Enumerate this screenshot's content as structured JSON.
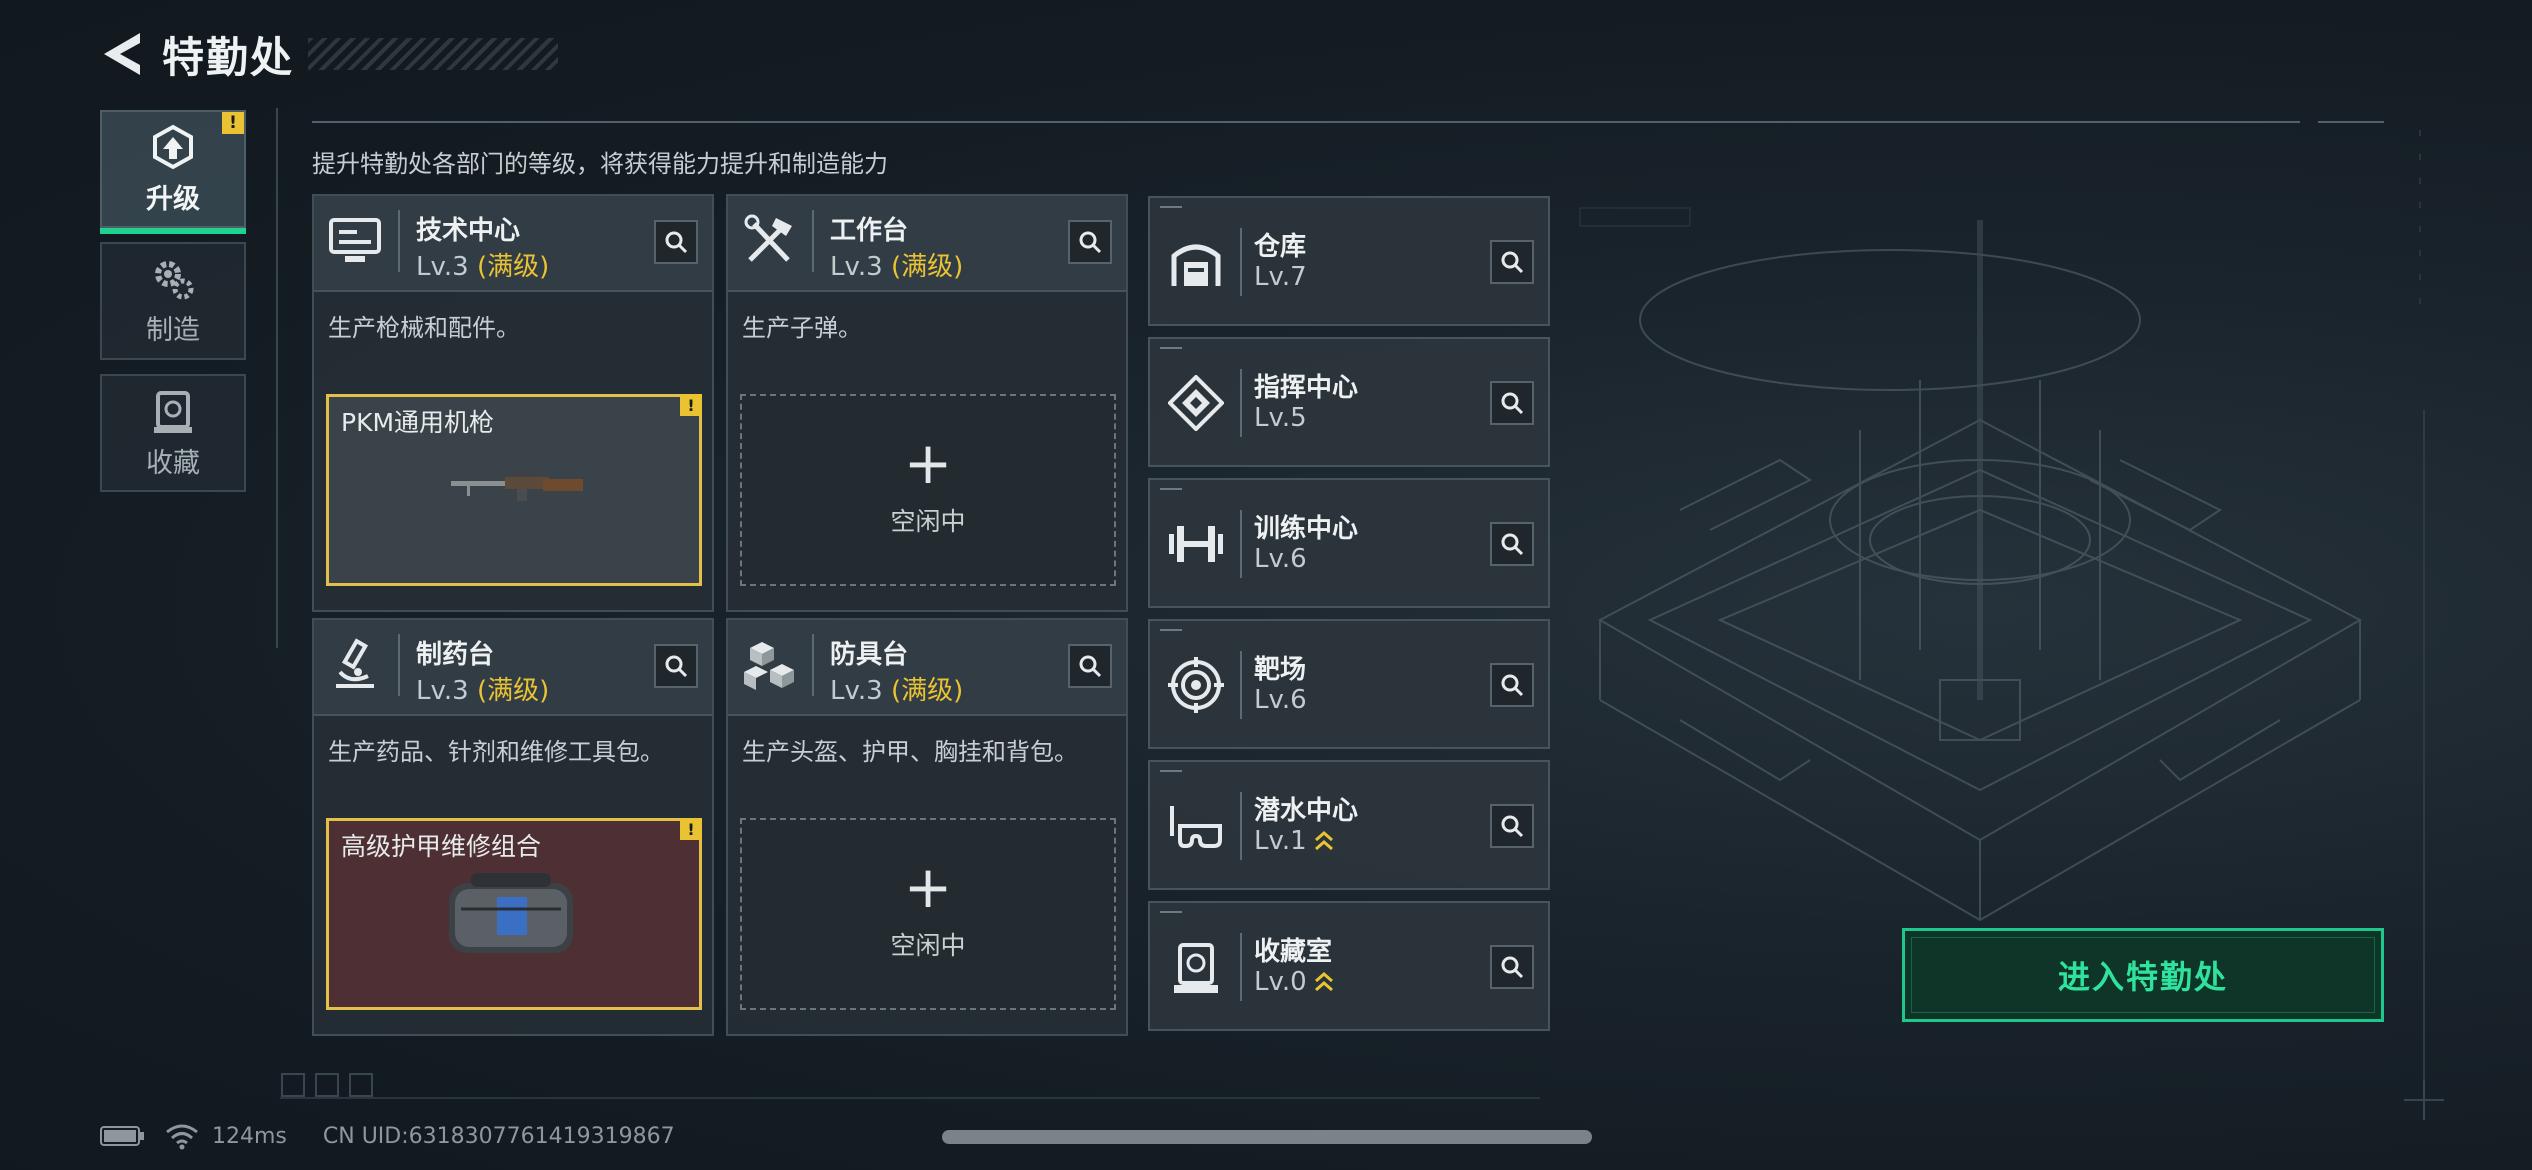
{
  "header": {
    "title": "特勤处"
  },
  "tabs": [
    {
      "id": "upgrade",
      "label": "升级",
      "active": true,
      "badge": "!"
    },
    {
      "id": "craft",
      "label": "制造",
      "active": false
    },
    {
      "id": "collection",
      "label": "收藏",
      "active": false
    }
  ],
  "description": "提升特勤处各部门的等级，将获得能力提升和制造能力",
  "departments": [
    {
      "name": "技术中心",
      "level": "Lv.3",
      "max_label": "(满级)",
      "desc": "生产枪械和配件。",
      "slot": {
        "type": "item",
        "name": "PKM通用机枪",
        "badge": "!",
        "color": "grey"
      }
    },
    {
      "name": "工作台",
      "level": "Lv.3",
      "max_label": "(满级)",
      "desc": "生产子弹。",
      "slot": {
        "type": "empty",
        "plus": "+",
        "idle": "空闲中"
      }
    },
    {
      "name": "制药台",
      "level": "Lv.3",
      "max_label": "(满级)",
      "desc": "生产药品、针剂和维修工具包。",
      "slot": {
        "type": "item",
        "name": "高级护甲维修组合",
        "badge": "!",
        "color": "red"
      }
    },
    {
      "name": "防具台",
      "level": "Lv.3",
      "max_label": "(满级)",
      "desc": "生产头盔、护甲、胸挂和背包。",
      "slot": {
        "type": "empty",
        "plus": "+",
        "idle": "空闲中"
      }
    }
  ],
  "facilities": [
    {
      "name": "仓库",
      "level": "Lv.7",
      "icon": "warehouse-icon",
      "upgradable": false
    },
    {
      "name": "指挥中心",
      "level": "Lv.5",
      "icon": "command-icon",
      "upgradable": false
    },
    {
      "name": "训练中心",
      "level": "Lv.6",
      "icon": "dumbbell-icon",
      "upgradable": false
    },
    {
      "name": "靶场",
      "level": "Lv.6",
      "icon": "target-icon",
      "upgradable": false
    },
    {
      "name": "潜水中心",
      "level": "Lv.1",
      "icon": "diving-mask-icon",
      "upgradable": true
    },
    {
      "name": "收藏室",
      "level": "Lv.0",
      "icon": "collection-room-icon",
      "upgradable": true
    }
  ],
  "enter_button": "进入特勤处",
  "status": {
    "ping": "124ms",
    "uid": "CN UID:6318307761419319867"
  },
  "colors": {
    "accent_green": "#1ec88a",
    "max_yellow": "#e9c332",
    "panel": "#2c353c"
  }
}
